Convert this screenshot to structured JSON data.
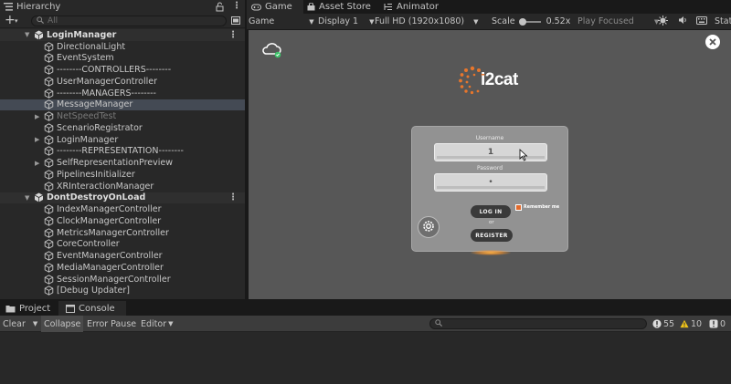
{
  "hierarchy": {
    "tab_label": "Hierarchy",
    "search_placeholder": "All",
    "items": [
      {
        "label": "LoginManager",
        "kind": "scene",
        "expanded": true
      },
      {
        "label": "DirectionalLight",
        "kind": "object"
      },
      {
        "label": "EventSystem",
        "kind": "object"
      },
      {
        "label": "--------CONTROLLERS--------",
        "kind": "object"
      },
      {
        "label": "UserManagerController",
        "kind": "object"
      },
      {
        "label": "--------MANAGERS--------",
        "kind": "object"
      },
      {
        "label": "MessageManager",
        "kind": "object",
        "selected": true
      },
      {
        "label": "NetSpeedTest",
        "kind": "object",
        "collapsed": true,
        "disabled": true
      },
      {
        "label": "ScenarioRegistrator",
        "kind": "object"
      },
      {
        "label": "LoginManager",
        "kind": "object",
        "collapsed": true
      },
      {
        "label": "--------REPRESENTATION--------",
        "kind": "object"
      },
      {
        "label": "SelfRepresentationPreview",
        "kind": "object",
        "collapsed": true
      },
      {
        "label": "PipelinesInitializer",
        "kind": "object"
      },
      {
        "label": "XRInteractionManager",
        "kind": "object"
      },
      {
        "label": "DontDestroyOnLoad",
        "kind": "scene",
        "expanded": true
      },
      {
        "label": "IndexManagerController",
        "kind": "object"
      },
      {
        "label": "ClockManagerController",
        "kind": "object"
      },
      {
        "label": "MetricsManagerController",
        "kind": "object"
      },
      {
        "label": "CoreController",
        "kind": "object"
      },
      {
        "label": "EventManagerController",
        "kind": "object"
      },
      {
        "label": "MediaManagerController",
        "kind": "object"
      },
      {
        "label": "SessionManagerController",
        "kind": "object"
      },
      {
        "label": "[Debug Updater]",
        "kind": "object"
      }
    ]
  },
  "game_tabs": [
    {
      "label": "Game",
      "icon": "gamepad-icon",
      "active": true
    },
    {
      "label": "Asset Store",
      "icon": "bag-icon",
      "active": false
    },
    {
      "label": "Animator",
      "icon": "animator-icon",
      "active": false
    }
  ],
  "game_toolbar": {
    "mode": "Game",
    "display": "Display 1",
    "resolution": "Full HD (1920x1080)",
    "scale_label": "Scale",
    "scale_value": "0.52x",
    "play_focus": "Play Focused",
    "stats": "Stat"
  },
  "login": {
    "logo_text": "i2cat",
    "username_label": "Username",
    "username_value": "1",
    "password_label": "Password",
    "password_value": "•",
    "login_button": "LOG IN",
    "or_text": "or",
    "register_button": "REGISTER",
    "remember_label": "Remember me"
  },
  "console": {
    "tabs": [
      {
        "label": "Project",
        "icon": "folder-icon",
        "active": false
      },
      {
        "label": "Console",
        "icon": "console-icon",
        "active": true
      }
    ],
    "clear": "Clear",
    "collapse": "Collapse",
    "error_pause": "Error Pause",
    "editor": "Editor",
    "count_errors": "55",
    "count_warnings": "10",
    "count_info": "0"
  },
  "colors": {
    "accent_orange": "#e8762c",
    "online_green": "#3fc36b",
    "panel_dark": "#282828",
    "viewport_gray": "#575757"
  }
}
